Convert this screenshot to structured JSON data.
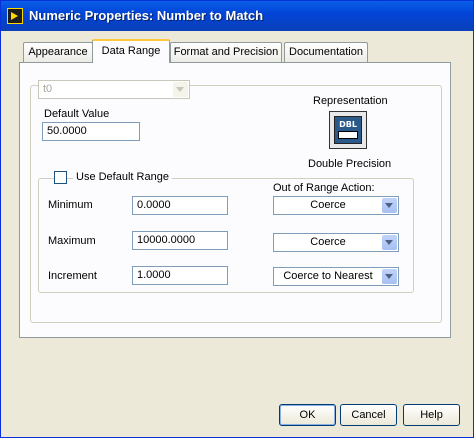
{
  "window": {
    "title": "Numeric Properties: Number to Match"
  },
  "tabs": [
    {
      "label": "Appearance"
    },
    {
      "label": "Data Range"
    },
    {
      "label": "Format and Precision"
    },
    {
      "label": "Documentation"
    }
  ],
  "data_range": {
    "type_select": {
      "value": "t0"
    },
    "default_value": {
      "label": "Default Value",
      "value": "50.0000"
    },
    "representation": {
      "label": "Representation",
      "icon_text": "DBL",
      "value": "Double Precision"
    },
    "use_default_range": {
      "label": "Use Default Range",
      "checked": false
    },
    "out_of_range_action_label": "Out of Range Action:",
    "rows": [
      {
        "label": "Minimum",
        "value": "0.0000",
        "action": "Coerce"
      },
      {
        "label": "Maximum",
        "value": "10000.0000",
        "action": "Coerce"
      },
      {
        "label": "Increment",
        "value": "1.0000",
        "action": "Coerce to Nearest"
      }
    ]
  },
  "buttons": {
    "ok": "OK",
    "cancel": "Cancel",
    "help": "Help"
  },
  "colors": {
    "title_bar": "#0a5fe8",
    "active_tab_accent": "#ffc83c",
    "dialog_bg": "#ece9d8"
  },
  "icons": [
    "labview-app-icon",
    "dropdown-arrow-icon",
    "dbl-representation-icon"
  ]
}
